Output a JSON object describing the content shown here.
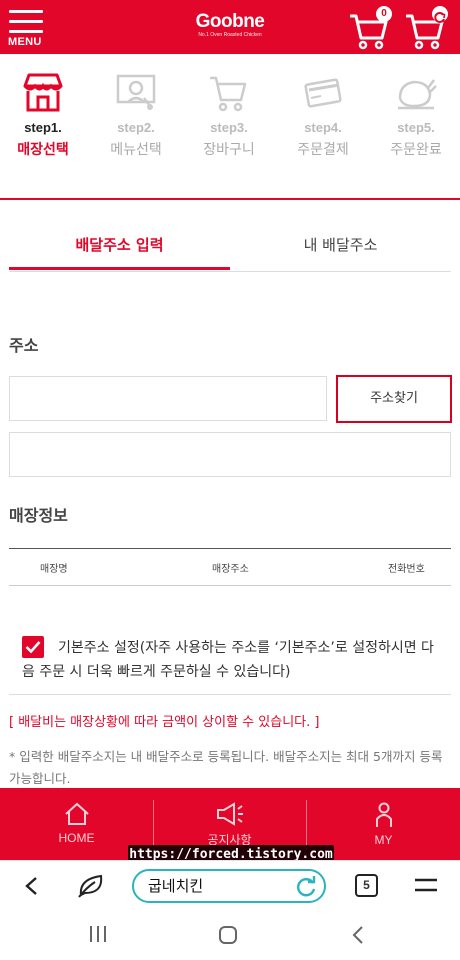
{
  "header": {
    "menu_label": "MENU",
    "logo_text": "Goobne",
    "logo_sub": "No.1 Oven Roasted Chicken",
    "cart_count": "0",
    "brand_color": "#e1062a"
  },
  "steps": [
    {
      "num": "step1.",
      "name": "매장선택",
      "icon": "store-icon",
      "active": true
    },
    {
      "num": "step2.",
      "name": "메뉴선택",
      "icon": "menu-board-icon",
      "active": false
    },
    {
      "num": "step3.",
      "name": "장바구니",
      "icon": "cart-icon",
      "active": false
    },
    {
      "num": "step4.",
      "name": "주문결제",
      "icon": "card-icon",
      "active": false
    },
    {
      "num": "step5.",
      "name": "주문완료",
      "icon": "chicken-icon",
      "active": false
    }
  ],
  "tabs": {
    "delivery_input": "배달주소 입력",
    "my_address": "내 배달주소"
  },
  "address": {
    "title": "주소",
    "input1_value": "",
    "input2_value": "",
    "find_button": "주소찾기"
  },
  "store": {
    "title": "매장정보",
    "col_name": "매장명",
    "col_address": "매장주소",
    "col_phone": "전화번호"
  },
  "default_address": {
    "checked": true,
    "label": "기본주소 설정(자주 사용하는 주소를 ‘기본주소’로 설정하시면 다음 주문 시 더욱 빠르게 주문하실 수 있습니다)"
  },
  "notice": "[ 배달비는 매장상황에 따라 금액이 상이할 수 있습니다. ]",
  "info": "* 입력한 배달주소지는 내 배달주소로 등록됩니다. 배달주소지는 최대 5개까지 등록 가능합니다.",
  "bottom_nav": [
    {
      "label": "HOME",
      "icon": "home-icon"
    },
    {
      "label": "공지사항",
      "icon": "megaphone-icon"
    },
    {
      "label": "MY",
      "icon": "person-icon"
    }
  ],
  "watermark": "https://forced.tistory.com",
  "browser": {
    "url_text": "굽네치킨",
    "tab_count": "5"
  }
}
